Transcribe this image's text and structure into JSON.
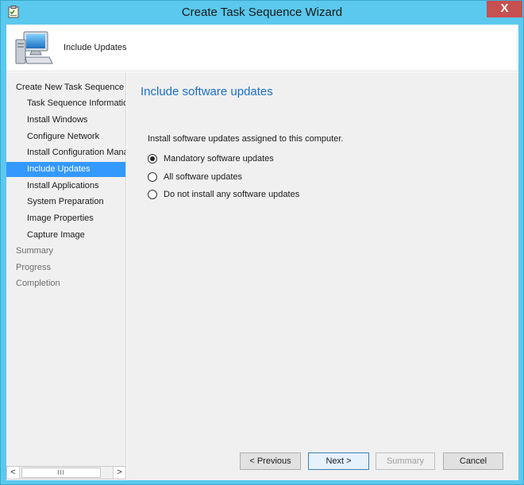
{
  "window": {
    "title": "Create Task Sequence Wizard",
    "close_glyph": "X",
    "accent_color": "#5bc8ed"
  },
  "header": {
    "title": "Include Updates",
    "icon": "computer-icon"
  },
  "nav": {
    "items": [
      {
        "label": "Create New Task Sequence",
        "level": 1,
        "state": "done"
      },
      {
        "label": "Task Sequence Information",
        "level": 2,
        "state": "done"
      },
      {
        "label": "Install Windows",
        "level": 2,
        "state": "done"
      },
      {
        "label": "Configure Network",
        "level": 2,
        "state": "done"
      },
      {
        "label": "Install Configuration Manager",
        "level": 2,
        "state": "done"
      },
      {
        "label": "Include Updates",
        "level": 2,
        "state": "selected"
      },
      {
        "label": "Install Applications",
        "level": 2,
        "state": "pending"
      },
      {
        "label": "System Preparation",
        "level": 2,
        "state": "pending"
      },
      {
        "label": "Image Properties",
        "level": 2,
        "state": "pending"
      },
      {
        "label": "Capture Image",
        "level": 2,
        "state": "pending"
      },
      {
        "label": "Summary",
        "level": 1,
        "state": "future"
      },
      {
        "label": "Progress",
        "level": 1,
        "state": "future"
      },
      {
        "label": "Completion",
        "level": 1,
        "state": "future"
      }
    ],
    "scroll_left": "<",
    "scroll_right": ">",
    "scroll_thumb": "III"
  },
  "content": {
    "heading": "Include software updates",
    "instruction": "Install software updates assigned to this computer.",
    "options": [
      {
        "label": "Mandatory software updates",
        "checked": true
      },
      {
        "label": "All software updates",
        "checked": false
      },
      {
        "label": "Do not install any software updates",
        "checked": false
      }
    ]
  },
  "buttons": {
    "previous": "< Previous",
    "next": "Next >",
    "summary": "Summary",
    "cancel": "Cancel"
  }
}
